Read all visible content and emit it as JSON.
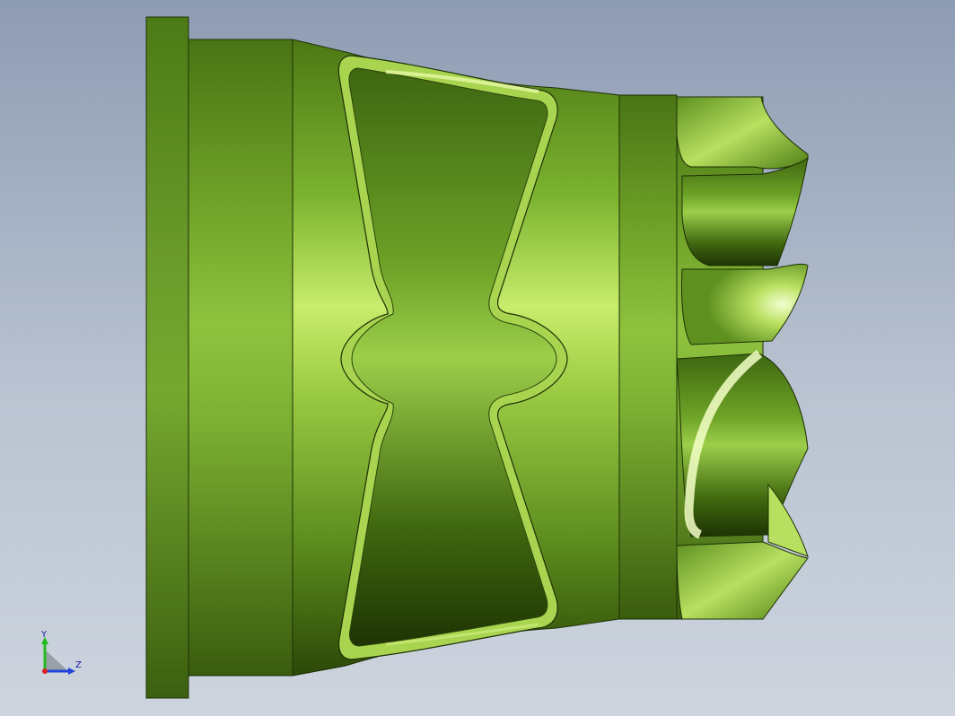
{
  "viewport": {
    "model_color": "#5a8a1e",
    "background_top": "#8e9cb3",
    "background_bottom": "#cdd4de"
  },
  "triad": {
    "y_label": "Y",
    "z_label": "Z",
    "y_color": "#22bb22",
    "z_color": "#2244dd",
    "x_color": "#dd2222"
  }
}
